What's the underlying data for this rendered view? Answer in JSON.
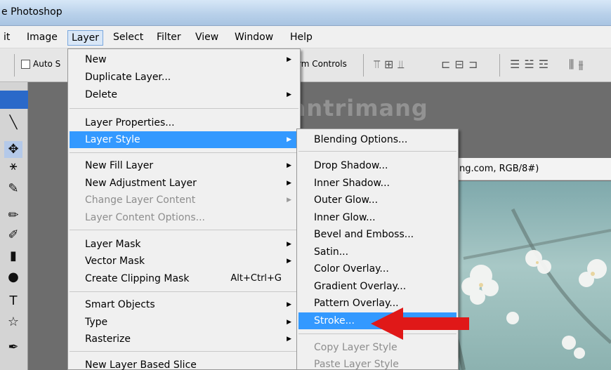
{
  "window": {
    "title": "e Photoshop"
  },
  "menubar": [
    {
      "label": "it",
      "active": false
    },
    {
      "label": "Image",
      "active": false
    },
    {
      "label": "Layer",
      "active": true
    },
    {
      "label": "Select",
      "active": false
    },
    {
      "label": "Filter",
      "active": false
    },
    {
      "label": "View",
      "active": false
    },
    {
      "label": "Window",
      "active": false
    },
    {
      "label": "Help",
      "active": false
    }
  ],
  "options_bar": {
    "auto_select_label": "Auto S",
    "transform_controls_label": "rm Controls"
  },
  "watermark": {
    "text": "uantrimang"
  },
  "document": {
    "tab_label": "ng.com, RGB/8#)"
  },
  "layer_menu": {
    "items": [
      {
        "label": "New",
        "submenu": true
      },
      {
        "label": "Duplicate Layer..."
      },
      {
        "label": "Delete",
        "submenu": true
      },
      {
        "label": "Layer Properties..."
      },
      {
        "label": "Layer Style",
        "submenu": true,
        "highlighted": true
      },
      {
        "label": "New Fill Layer",
        "submenu": true
      },
      {
        "label": "New Adjustment Layer",
        "submenu": true
      },
      {
        "label": "Change Layer Content",
        "submenu": true,
        "disabled": true
      },
      {
        "label": "Layer Content Options...",
        "disabled": true
      },
      {
        "label": "Layer Mask",
        "submenu": true
      },
      {
        "label": "Vector Mask",
        "submenu": true
      },
      {
        "label": "Create Clipping Mask",
        "shortcut": "Alt+Ctrl+G"
      },
      {
        "label": "Smart Objects",
        "submenu": true
      },
      {
        "label": "Type",
        "submenu": true
      },
      {
        "label": "Rasterize",
        "submenu": true
      },
      {
        "label": "New Layer Based Slice"
      }
    ]
  },
  "layer_style_menu": {
    "items": [
      {
        "label": "Blending Options..."
      },
      {
        "label": "Drop Shadow..."
      },
      {
        "label": "Inner Shadow..."
      },
      {
        "label": "Outer Glow..."
      },
      {
        "label": "Inner Glow..."
      },
      {
        "label": "Bevel and Emboss..."
      },
      {
        "label": "Satin..."
      },
      {
        "label": "Color Overlay..."
      },
      {
        "label": "Gradient Overlay..."
      },
      {
        "label": "Pattern Overlay..."
      },
      {
        "label": "Stroke...",
        "highlighted": true
      },
      {
        "label": "Copy Layer Style",
        "disabled": true
      },
      {
        "label": "Paste Layer Style",
        "disabled": true
      }
    ]
  },
  "colors": {
    "highlight": "#3399ff",
    "arrow": "#e01818",
    "menu_bg": "#f0f0f0"
  }
}
